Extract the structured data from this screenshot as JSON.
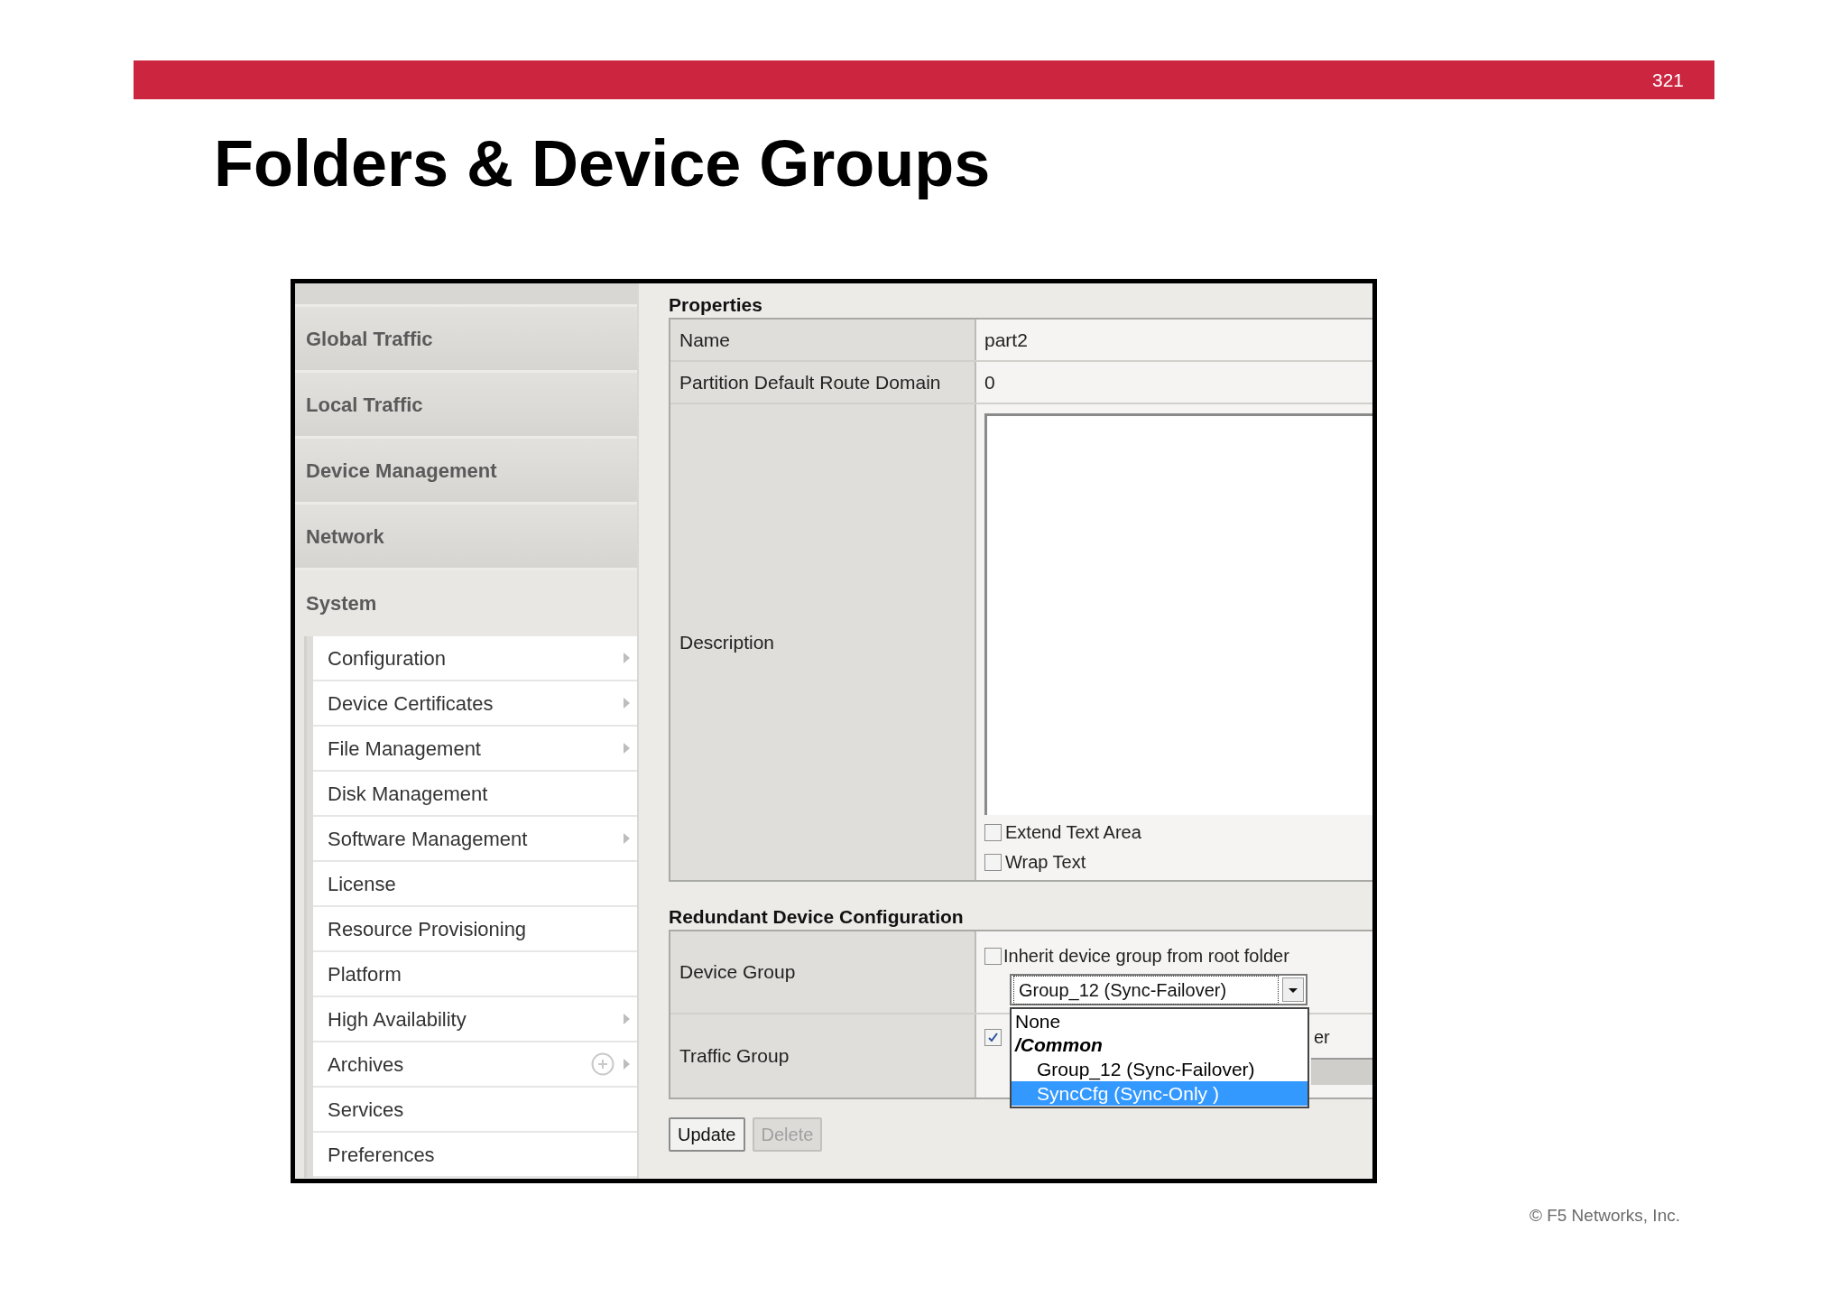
{
  "slide": {
    "page_number": "321",
    "title": "Folders & Device Groups",
    "footer": "© F5 Networks, Inc."
  },
  "sidebar": {
    "sections": [
      {
        "label": "Global Traffic",
        "expanded": false
      },
      {
        "label": "Local Traffic",
        "expanded": false
      },
      {
        "label": "Device Management",
        "expanded": false
      },
      {
        "label": "Network",
        "expanded": false
      },
      {
        "label": "System",
        "expanded": true,
        "children": [
          {
            "label": "Configuration",
            "has_submenu": true
          },
          {
            "label": "Device Certificates",
            "has_submenu": true
          },
          {
            "label": "File Management",
            "has_submenu": true
          },
          {
            "label": "Disk Management",
            "has_submenu": false
          },
          {
            "label": "Software Management",
            "has_submenu": true
          },
          {
            "label": "License",
            "has_submenu": false
          },
          {
            "label": "Resource Provisioning",
            "has_submenu": false
          },
          {
            "label": "Platform",
            "has_submenu": false
          },
          {
            "label": "High Availability",
            "has_submenu": true
          },
          {
            "label": "Archives",
            "has_submenu": true,
            "has_add": true
          },
          {
            "label": "Services",
            "has_submenu": false
          },
          {
            "label": "Preferences",
            "has_submenu": false
          }
        ]
      }
    ]
  },
  "properties": {
    "title": "Properties",
    "rows": [
      {
        "kind": "text",
        "label": "Name",
        "value": "part2"
      },
      {
        "kind": "text",
        "label": "Partition Default Route Domain",
        "value": "0"
      },
      {
        "kind": "textarea",
        "label": "Description",
        "options": [
          {
            "label": "Extend Text Area",
            "checked": false
          },
          {
            "label": "Wrap Text",
            "checked": false
          }
        ]
      }
    ]
  },
  "redundant": {
    "title": "Redundant Device Configuration",
    "device_group": {
      "label": "Device Group",
      "inherit": {
        "label": "Inherit device group from root folder",
        "checked": false
      },
      "select": {
        "value": "Group_12 (Sync-Failover)",
        "expanded": true,
        "options": [
          {
            "kind": "option",
            "label": "None",
            "selected": false
          },
          {
            "kind": "group",
            "label": "/Common",
            "children": [
              {
                "kind": "option",
                "label": "Group_12 (Sync-Failover)",
                "selected": false
              },
              {
                "kind": "option",
                "label": "SyncCfg (Sync-Only )",
                "selected": true
              }
            ]
          }
        ]
      }
    },
    "traffic_group": {
      "label": "Traffic Group",
      "inherit": {
        "label": "er",
        "checked": true
      }
    }
  },
  "buttons": [
    {
      "label": "Update",
      "disabled": false
    },
    {
      "label": "Delete",
      "disabled": true
    }
  ]
}
